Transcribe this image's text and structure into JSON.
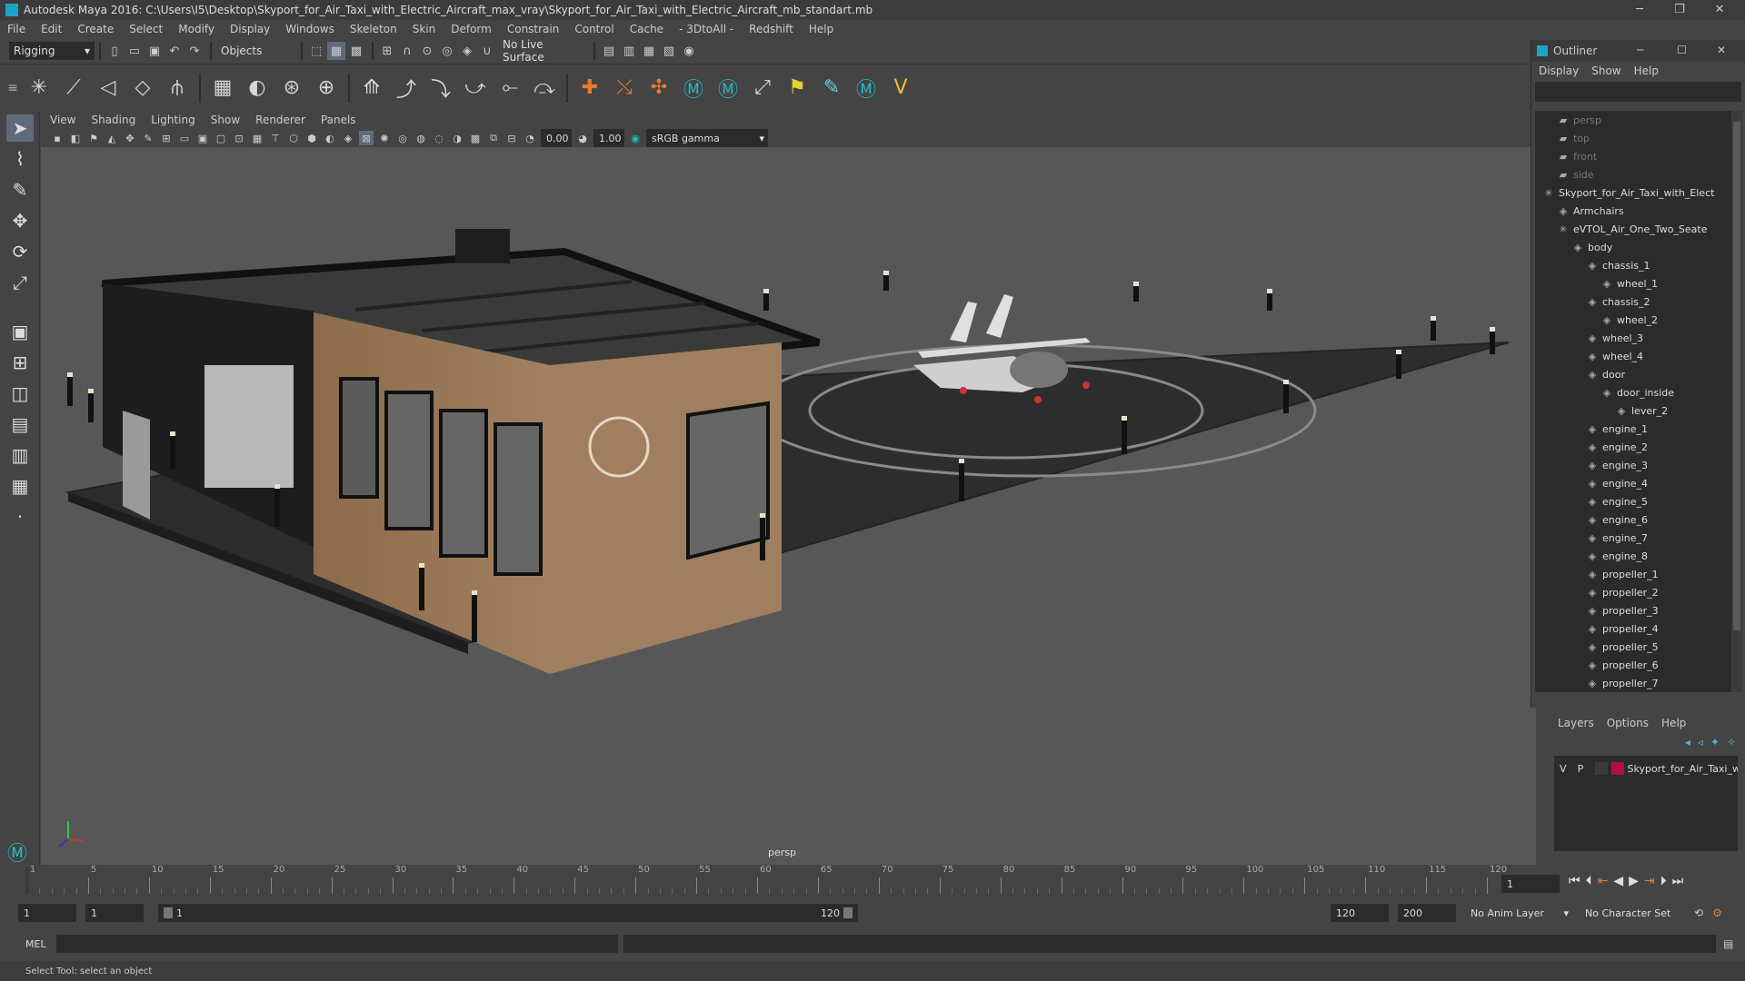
{
  "app": {
    "title": "Autodesk Maya 2016: C:\\Users\\I5\\Desktop\\Skyport_for_Air_Taxi_with_Electric_Aircraft_max_vray\\Skyport_for_Air_Taxi_with_Electric_Aircraft_mb_standart.mb"
  },
  "menu": [
    "File",
    "Edit",
    "Create",
    "Select",
    "Modify",
    "Display",
    "Windows",
    "Skeleton",
    "Skin",
    "Deform",
    "Constrain",
    "Control",
    "Cache",
    "- 3DtoAll -",
    "Redshift",
    "Help"
  ],
  "status": {
    "mode": "Rigging",
    "objects": "Objects",
    "live_surface": "No Live Surface"
  },
  "viewport": {
    "menu": [
      "View",
      "Shading",
      "Lighting",
      "Show",
      "Renderer",
      "Panels"
    ],
    "field_a": "0.00",
    "field_b": "1.00",
    "color_space": "sRGB gamma",
    "camera_label": "persp"
  },
  "outliner": {
    "title": "Outliner",
    "menu": [
      "Display",
      "Show",
      "Help"
    ],
    "items": [
      {
        "label": "persp",
        "dim": true,
        "depth": 1,
        "icon": "camera-icon"
      },
      {
        "label": "top",
        "dim": true,
        "depth": 1,
        "icon": "camera-icon"
      },
      {
        "label": "front",
        "dim": true,
        "depth": 1,
        "icon": "camera-icon"
      },
      {
        "label": "side",
        "dim": true,
        "depth": 1,
        "icon": "camera-icon"
      },
      {
        "label": "Skyport_for_Air_Taxi_with_Elect",
        "dim": false,
        "depth": 0,
        "icon": "group-icon"
      },
      {
        "label": "Armchairs",
        "dim": false,
        "depth": 1,
        "icon": "mesh-icon"
      },
      {
        "label": "eVTOL_Air_One_Two_Seate",
        "dim": false,
        "depth": 1,
        "icon": "group-icon"
      },
      {
        "label": "body",
        "dim": false,
        "depth": 2,
        "icon": "mesh-icon"
      },
      {
        "label": "chassis_1",
        "dim": false,
        "depth": 3,
        "icon": "mesh-icon"
      },
      {
        "label": "wheel_1",
        "dim": false,
        "depth": 4,
        "icon": "mesh-icon"
      },
      {
        "label": "chassis_2",
        "dim": false,
        "depth": 3,
        "icon": "mesh-icon"
      },
      {
        "label": "wheel_2",
        "dim": false,
        "depth": 4,
        "icon": "mesh-icon"
      },
      {
        "label": "wheel_3",
        "dim": false,
        "depth": 3,
        "icon": "mesh-icon"
      },
      {
        "label": "wheel_4",
        "dim": false,
        "depth": 3,
        "icon": "mesh-icon"
      },
      {
        "label": "door",
        "dim": false,
        "depth": 3,
        "icon": "mesh-icon"
      },
      {
        "label": "door_inside",
        "dim": false,
        "depth": 4,
        "icon": "mesh-icon"
      },
      {
        "label": "lever_2",
        "dim": false,
        "depth": 5,
        "icon": "mesh-icon"
      },
      {
        "label": "engine_1",
        "dim": false,
        "depth": 3,
        "icon": "mesh-icon"
      },
      {
        "label": "engine_2",
        "dim": false,
        "depth": 3,
        "icon": "mesh-icon"
      },
      {
        "label": "engine_3",
        "dim": false,
        "depth": 3,
        "icon": "mesh-icon"
      },
      {
        "label": "engine_4",
        "dim": false,
        "depth": 3,
        "icon": "mesh-icon"
      },
      {
        "label": "engine_5",
        "dim": false,
        "depth": 3,
        "icon": "mesh-icon"
      },
      {
        "label": "engine_6",
        "dim": false,
        "depth": 3,
        "icon": "mesh-icon"
      },
      {
        "label": "engine_7",
        "dim": false,
        "depth": 3,
        "icon": "mesh-icon"
      },
      {
        "label": "engine_8",
        "dim": false,
        "depth": 3,
        "icon": "mesh-icon"
      },
      {
        "label": "propeller_1",
        "dim": false,
        "depth": 3,
        "icon": "mesh-icon"
      },
      {
        "label": "propeller_2",
        "dim": false,
        "depth": 3,
        "icon": "mesh-icon"
      },
      {
        "label": "propeller_3",
        "dim": false,
        "depth": 3,
        "icon": "mesh-icon"
      },
      {
        "label": "propeller_4",
        "dim": false,
        "depth": 3,
        "icon": "mesh-icon"
      },
      {
        "label": "propeller_5",
        "dim": false,
        "depth": 3,
        "icon": "mesh-icon"
      },
      {
        "label": "propeller_6",
        "dim": false,
        "depth": 3,
        "icon": "mesh-icon"
      },
      {
        "label": "propeller_7",
        "dim": false,
        "depth": 3,
        "icon": "mesh-icon"
      }
    ]
  },
  "layers": {
    "menu": [
      "Layers",
      "Options",
      "Help"
    ],
    "row": {
      "v": "V",
      "p": "P",
      "name": "Skyport_for_Air_Taxi_w",
      "color": "#b0103a"
    }
  },
  "timeline": {
    "ticks": [
      "1",
      "5",
      "10",
      "15",
      "20",
      "25",
      "30",
      "35",
      "40",
      "45",
      "50",
      "55",
      "60",
      "65",
      "70",
      "75",
      "80",
      "85",
      "90",
      "95",
      "100",
      "105",
      "110",
      "115",
      "120"
    ],
    "current": "1"
  },
  "range": {
    "start": "1",
    "start2": "1",
    "slider_start": "1",
    "slider_end": "120",
    "end": "120",
    "end2": "200",
    "anim_layer": "No Anim Layer",
    "char_set": "No Character Set"
  },
  "cmd": {
    "lang": "MEL"
  },
  "help": {
    "text": "Select Tool: select an object"
  }
}
